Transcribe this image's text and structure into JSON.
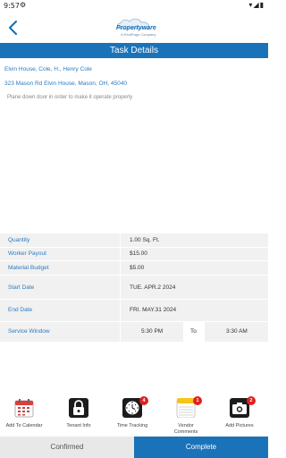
{
  "status_bar": {
    "time": "9:57"
  },
  "header": {
    "logo_text": "Propertyware",
    "logo_sub": "A RealPage Company"
  },
  "title": "Task Details",
  "address": {
    "line1": "Elvin House, Cole, H., Henry Cole",
    "line2": "323 Mason Rd  Elvin House, Mason, OH, 45040"
  },
  "description": "Plane down door in order to make it operate properly",
  "details": [
    {
      "label": "Quantity",
      "value": "1.00 Sq. Ft."
    },
    {
      "label": "Worker Payout",
      "value": "$15.00"
    },
    {
      "label": "Material Budget",
      "value": "$5.00"
    },
    {
      "label": "Start Date",
      "value": "TUE. APR.2  2024"
    },
    {
      "label": "End Date",
      "value": "FRI. MAY.31  2024"
    }
  ],
  "service_window": {
    "label": "Service Window",
    "start": "5:30 PM",
    "to": "To",
    "end": "3:30 AM"
  },
  "actions": [
    {
      "label": "Add To Calendar",
      "badge": ""
    },
    {
      "label": "Tenant Info",
      "badge": ""
    },
    {
      "label": "Time Tracking",
      "badge": "4"
    },
    {
      "label": "Vendor Comments",
      "badge": "1"
    },
    {
      "label": "Add Pictures",
      "badge": "2"
    }
  ],
  "tabs": {
    "confirmed": "Confirmed",
    "complete": "Complete"
  },
  "colors": {
    "accent": "#1a73b8",
    "link": "#2a7bc0",
    "badge": "#e02020"
  }
}
